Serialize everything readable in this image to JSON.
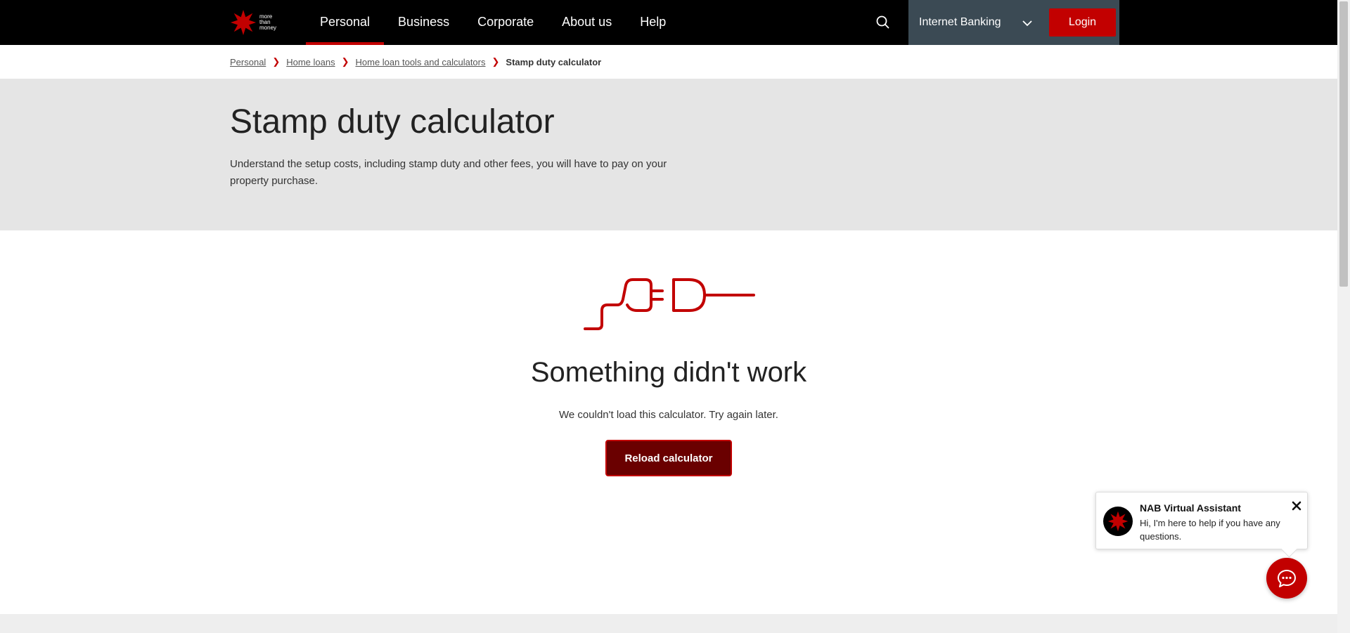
{
  "header": {
    "logo_text": [
      "more",
      "than",
      "money"
    ],
    "nav": [
      {
        "label": "Personal",
        "active": true
      },
      {
        "label": "Business",
        "active": false
      },
      {
        "label": "Corporate",
        "active": false
      },
      {
        "label": "About us",
        "active": false
      },
      {
        "label": "Help",
        "active": false
      }
    ],
    "internet_banking_label": "Internet Banking",
    "login_label": "Login"
  },
  "breadcrumb": {
    "items": [
      "Personal",
      "Home loans",
      "Home loan tools and calculators"
    ],
    "current": "Stamp duty calculator"
  },
  "hero": {
    "title": "Stamp duty calculator",
    "description": "Understand the setup costs, including stamp duty and other fees, you will have to pay on your property purchase."
  },
  "error": {
    "title": "Something didn't work",
    "message": "We couldn't load this calculator. Try again later.",
    "button_label": "Reload calculator"
  },
  "assistant": {
    "title": "NAB Virtual Assistant",
    "message": "Hi, I'm here to help if you have any questions."
  },
  "colors": {
    "brand_red": "#c20000",
    "dark_red": "#6a0000",
    "nav_bg": "#000000",
    "hero_bg": "#e5e5e5"
  }
}
